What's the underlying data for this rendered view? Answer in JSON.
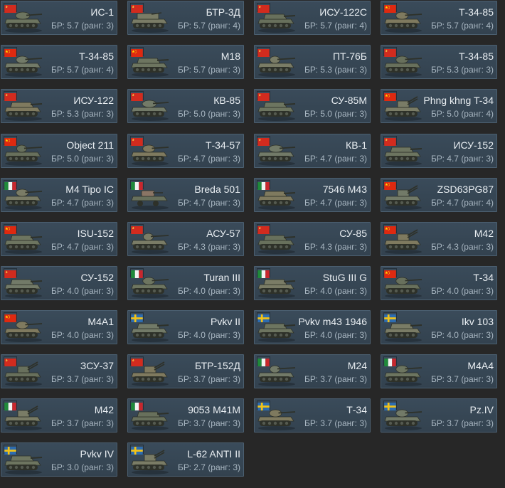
{
  "br_prefix": "БР: ",
  "rank_word": "ранг:",
  "flag_colors": {
    "ussr": "#d22b1e",
    "china": "#de2910",
    "italy": [
      "#1f8a3a",
      "#f1f2f1",
      "#c8272d"
    ],
    "sweden": [
      "#2d6cb0",
      "#f2c318"
    ]
  },
  "vehicles": [
    {
      "name": "ИС-1",
      "br": "5.7",
      "rank": "3",
      "flag": "ussr",
      "icon": "heavy-tank-icon"
    },
    {
      "name": "БТР-3Д",
      "br": "5.7",
      "rank": "4",
      "flag": "ussr",
      "icon": "ifv-icon"
    },
    {
      "name": "ИСУ-122С",
      "br": "5.7",
      "rank": "4",
      "flag": "ussr",
      "icon": "tank-destroyer-icon"
    },
    {
      "name": "Т-34-85",
      "br": "5.7",
      "rank": "4",
      "flag": "china",
      "icon": "medium-tank-icon"
    },
    {
      "name": "Т-34-85",
      "br": "5.7",
      "rank": "4",
      "flag": "china",
      "icon": "medium-tank-icon"
    },
    {
      "name": "M18",
      "br": "5.7",
      "rank": "3",
      "flag": "china",
      "icon": "tank-destroyer-icon"
    },
    {
      "name": "ПТ-76Б",
      "br": "5.3",
      "rank": "3",
      "flag": "ussr",
      "icon": "light-tank-icon"
    },
    {
      "name": "Т-34-85",
      "br": "5.3",
      "rank": "3",
      "flag": "ussr",
      "icon": "medium-tank-icon"
    },
    {
      "name": "ИСУ-122",
      "br": "5.3",
      "rank": "3",
      "flag": "ussr",
      "icon": "tank-destroyer-icon"
    },
    {
      "name": "КВ-85",
      "br": "5.0",
      "rank": "3",
      "flag": "ussr",
      "icon": "heavy-tank-icon"
    },
    {
      "name": "СУ-85М",
      "br": "5.0",
      "rank": "3",
      "flag": "ussr",
      "icon": "tank-destroyer-icon"
    },
    {
      "name": "Phng khng T-34",
      "br": "5.0",
      "rank": "4",
      "flag": "china",
      "icon": "spaa-icon"
    },
    {
      "name": "Object 211",
      "br": "5.0",
      "rank": "3",
      "flag": "china",
      "icon": "light-tank-icon"
    },
    {
      "name": "Т-34-57",
      "br": "4.7",
      "rank": "3",
      "flag": "ussr",
      "icon": "medium-tank-icon"
    },
    {
      "name": "КВ-1",
      "br": "4.7",
      "rank": "3",
      "flag": "ussr",
      "icon": "heavy-tank-icon"
    },
    {
      "name": "ИСУ-152",
      "br": "4.7",
      "rank": "3",
      "flag": "ussr",
      "icon": "tank-destroyer-icon"
    },
    {
      "name": "M4 Tipo IC",
      "br": "4.7",
      "rank": "3",
      "flag": "italy",
      "icon": "medium-tank-icon"
    },
    {
      "name": "Breda 501",
      "br": "4.7",
      "rank": "3",
      "flag": "italy",
      "icon": "armored-car-icon"
    },
    {
      "name": "7546 M43",
      "br": "4.7",
      "rank": "3",
      "flag": "italy",
      "icon": "tank-destroyer-icon"
    },
    {
      "name": "ZSD63PG87",
      "br": "4.7",
      "rank": "4",
      "flag": "china",
      "icon": "spaa-icon"
    },
    {
      "name": "ISU-152",
      "br": "4.7",
      "rank": "3",
      "flag": "china",
      "icon": "tank-destroyer-icon"
    },
    {
      "name": "АСУ-57",
      "br": "4.3",
      "rank": "3",
      "flag": "ussr",
      "icon": "light-tank-icon"
    },
    {
      "name": "СУ-85",
      "br": "4.3",
      "rank": "3",
      "flag": "ussr",
      "icon": "tank-destroyer-icon"
    },
    {
      "name": "M42",
      "br": "4.3",
      "rank": "3",
      "flag": "china",
      "icon": "spaa-icon"
    },
    {
      "name": "СУ-152",
      "br": "4.0",
      "rank": "3",
      "flag": "ussr",
      "icon": "tank-destroyer-icon"
    },
    {
      "name": "Turan III",
      "br": "4.0",
      "rank": "3",
      "flag": "italy",
      "icon": "medium-tank-icon"
    },
    {
      "name": "StuG III G",
      "br": "4.0",
      "rank": "3",
      "flag": "italy",
      "icon": "tank-destroyer-icon"
    },
    {
      "name": "Т-34",
      "br": "4.0",
      "rank": "3",
      "flag": "china",
      "icon": "medium-tank-icon"
    },
    {
      "name": "M4A1",
      "br": "4.0",
      "rank": "3",
      "flag": "china",
      "icon": "medium-tank-icon"
    },
    {
      "name": "Pvkv II",
      "br": "4.0",
      "rank": "3",
      "flag": "sweden",
      "icon": "tank-destroyer-icon"
    },
    {
      "name": "Pvkv m43 1946",
      "br": "4.0",
      "rank": "3",
      "flag": "sweden",
      "icon": "tank-destroyer-icon"
    },
    {
      "name": "Ikv 103",
      "br": "4.0",
      "rank": "3",
      "flag": "sweden",
      "icon": "tank-destroyer-icon"
    },
    {
      "name": "ЗСУ-37",
      "br": "3.7",
      "rank": "3",
      "flag": "ussr",
      "icon": "spaa-icon"
    },
    {
      "name": "БТР-152Д",
      "br": "3.7",
      "rank": "3",
      "flag": "ussr",
      "icon": "spaa-icon"
    },
    {
      "name": "M24",
      "br": "3.7",
      "rank": "3",
      "flag": "italy",
      "icon": "light-tank-icon"
    },
    {
      "name": "M4A4",
      "br": "3.7",
      "rank": "3",
      "flag": "italy",
      "icon": "medium-tank-icon"
    },
    {
      "name": "M42",
      "br": "3.7",
      "rank": "3",
      "flag": "italy",
      "icon": "spaa-icon"
    },
    {
      "name": "9053 M41M",
      "br": "3.7",
      "rank": "3",
      "flag": "italy",
      "icon": "tank-destroyer-icon"
    },
    {
      "name": "Т-34",
      "br": "3.7",
      "rank": "3",
      "flag": "sweden",
      "icon": "medium-tank-icon"
    },
    {
      "name": "Pz.IV",
      "br": "3.7",
      "rank": "3",
      "flag": "sweden",
      "icon": "medium-tank-icon"
    },
    {
      "name": "Pvkv IV",
      "br": "3.0",
      "rank": "3",
      "flag": "sweden",
      "icon": "tank-destroyer-icon"
    },
    {
      "name": "L-62 ANTI II",
      "br": "2.7",
      "rank": "3",
      "flag": "sweden",
      "icon": "spaa-icon"
    }
  ]
}
